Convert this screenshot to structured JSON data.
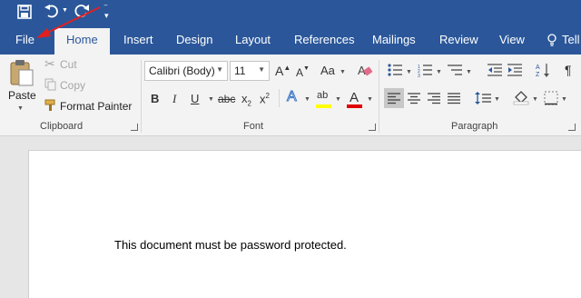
{
  "quick_access": {
    "save_icon": "save-icon",
    "undo_icon": "undo-icon",
    "redo_icon": "redo-icon",
    "customize_icon": "chevron-down-icon"
  },
  "tabs": {
    "file": "File",
    "home": "Home",
    "insert": "Insert",
    "design": "Design",
    "layout": "Layout",
    "references": "References",
    "mailings": "Mailings",
    "review": "Review",
    "view": "View",
    "tell": "Tell"
  },
  "clipboard": {
    "paste": "Paste",
    "cut": "Cut",
    "copy": "Copy",
    "format_painter": "Format Painter",
    "group_label": "Clipboard"
  },
  "font": {
    "font_name": "Calibri (Body)",
    "font_size": "11",
    "bold": "B",
    "italic": "I",
    "underline": "U",
    "strikethrough": "abc",
    "subscript": "x",
    "subscript_sub": "2",
    "superscript": "x",
    "superscript_sup": "2",
    "change_case": "Aa",
    "text_effects": "A",
    "highlight": "ab",
    "font_color": "A",
    "grow": "A",
    "shrink": "A",
    "group_label": "Font",
    "highlight_color": "#ffff00",
    "font_color_bar": "#e00000"
  },
  "paragraph": {
    "group_label": "Paragraph"
  },
  "colors": {
    "brand": "#2b579a",
    "annotation_arrow": "#e02020"
  },
  "document": {
    "body_text": "This document must be password protected."
  }
}
